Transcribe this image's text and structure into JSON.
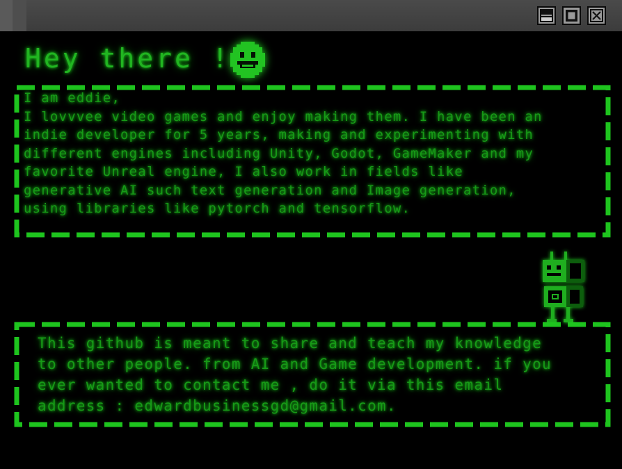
{
  "window": {
    "buttons": [
      {
        "name": "minimize",
        "icon": "minimize-icon"
      },
      {
        "name": "maximize",
        "icon": "maximize-icon"
      },
      {
        "name": "close",
        "icon": "close-icon"
      }
    ]
  },
  "colors": {
    "background": "#000000",
    "accent_green": "#1fae1f",
    "titlebar": "#444444"
  },
  "heading": {
    "text": "Hey there !",
    "icon": "smiley-icon"
  },
  "about": {
    "lines": [
      "I am eddie,",
      "I lovvvee video games and enjoy making them. I have been an",
      "indie developer for 5 years, making and experimenting with",
      "different engines including Unity, Godot, GameMaker and my",
      "favorite Unreal engine, I also work in fields like",
      "generative AI such text generation and Image generation,",
      "using libraries like pytorch and tensorflow."
    ]
  },
  "mascot": {
    "icon": "robot-icon"
  },
  "contact": {
    "lines": [
      "This github is meant to share and teach my knowledge",
      "to other people. from AI and Game development. if you",
      "ever wanted to contact me , do it via this email",
      "address : edwardbusinessgd@gmail.com."
    ]
  }
}
